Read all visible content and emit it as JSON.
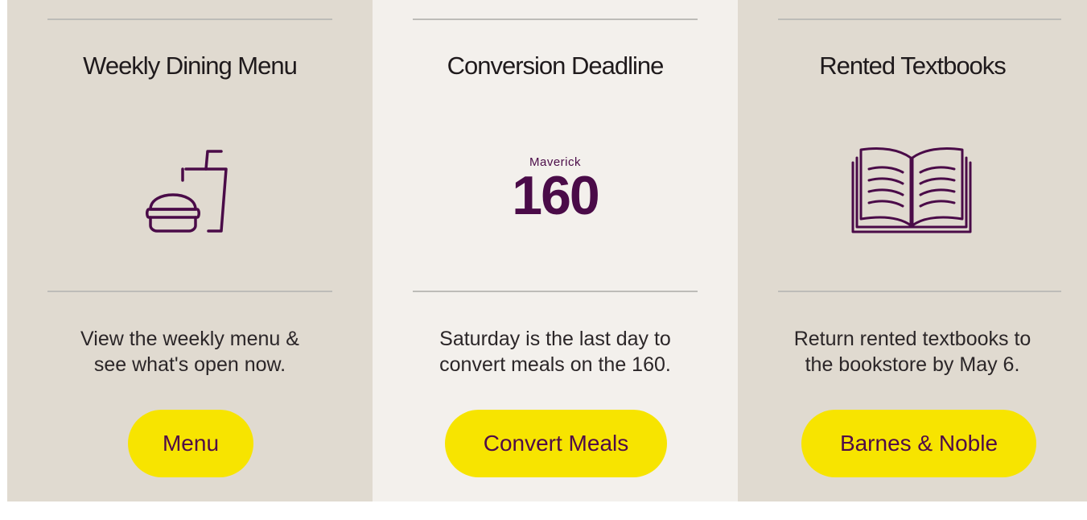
{
  "cards": [
    {
      "title": "Weekly Dining Menu",
      "icon": "burger-drink-icon",
      "description_line1": "View the weekly menu &",
      "description_line2": "see what's open now.",
      "button_label": "Menu"
    },
    {
      "title": "Conversion Deadline",
      "logo_small": "Maverick",
      "logo_big": "160",
      "description_line1": "Saturday is the last day to",
      "description_line2": "convert meals on the 160.",
      "button_label": "Convert Meals"
    },
    {
      "title": "Rented Textbooks",
      "icon": "open-book-icon",
      "description_line1": "Return rented textbooks to",
      "description_line2": "the bookstore by May 6.",
      "button_label": "Barnes & Noble"
    }
  ],
  "colors": {
    "card_dark_bg": "#e0dad0",
    "card_light_bg": "#f3f0ec",
    "button_bg": "#f7e400",
    "accent_purple": "#4f0b48"
  }
}
